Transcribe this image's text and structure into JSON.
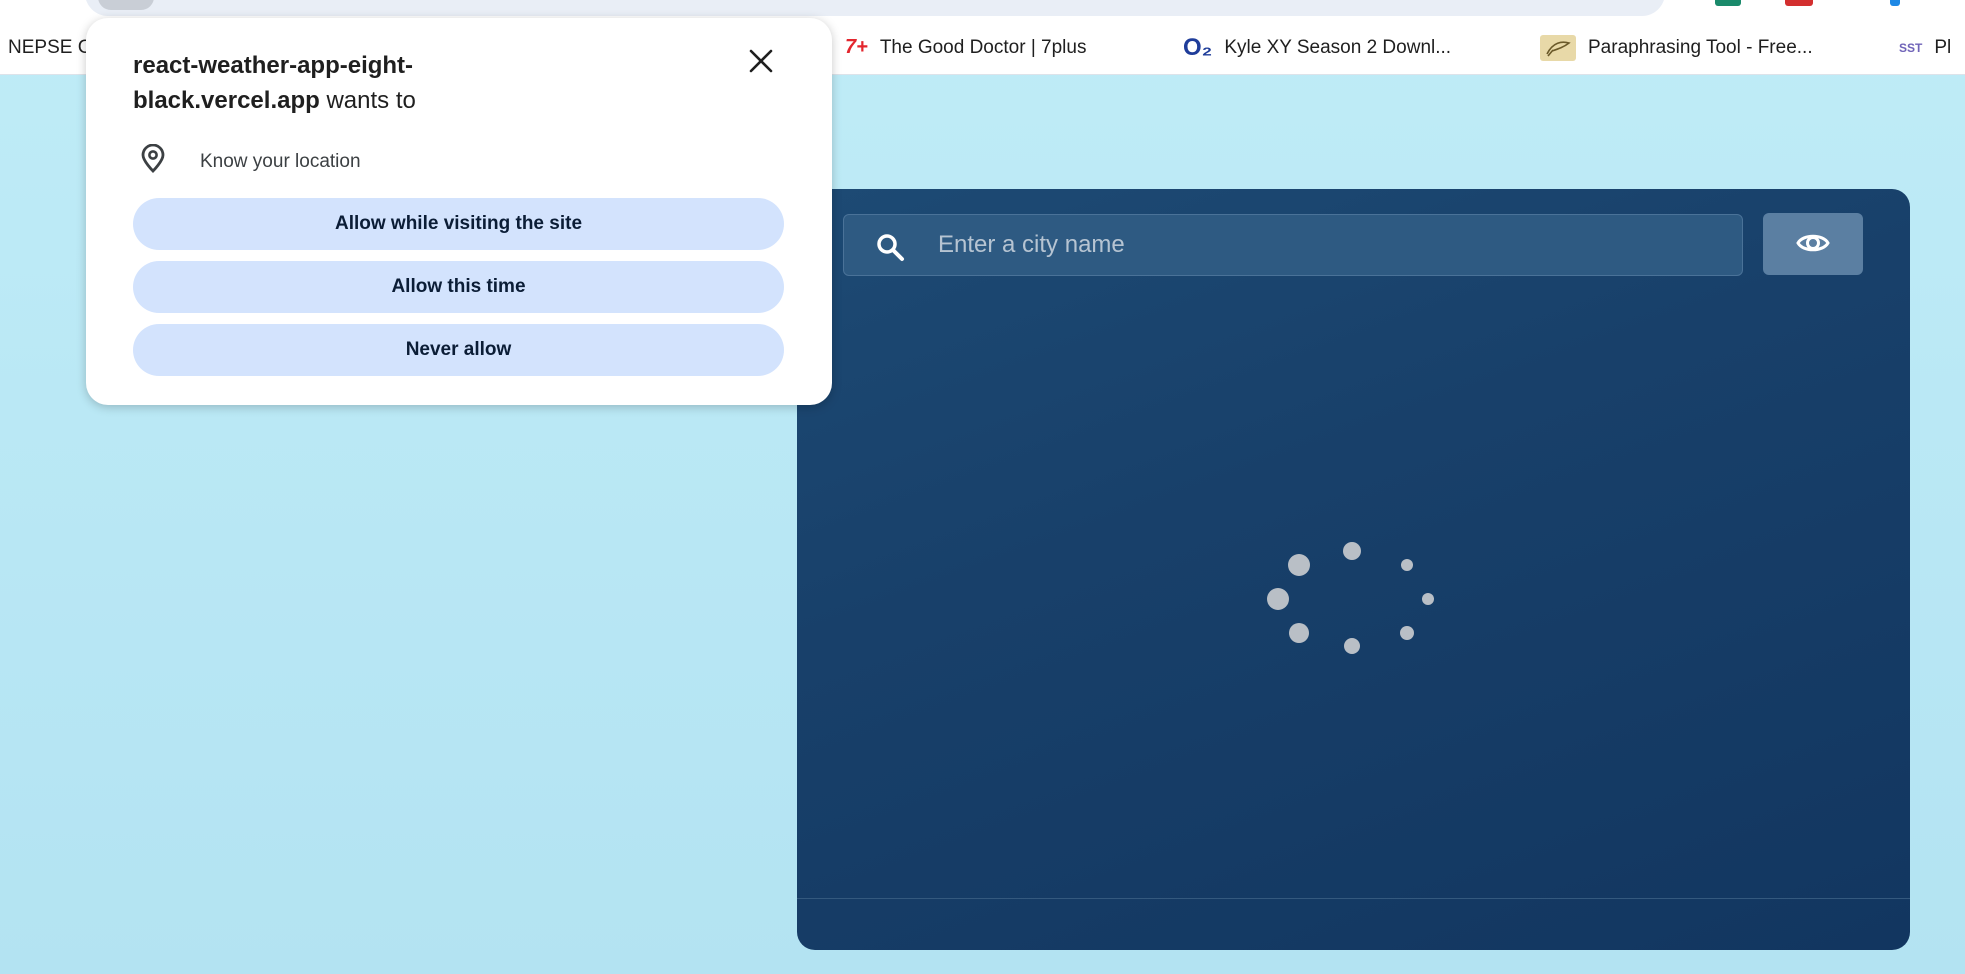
{
  "bookmarks": [
    {
      "label": "NEPSE C",
      "icon": "nepse-icon"
    },
    {
      "label": "The Good Doctor | 7plus",
      "icon": "7plus-icon",
      "fav_text": "7+",
      "fav_color": "#e3262e"
    },
    {
      "label": "Kyle XY Season 2 Downl...",
      "icon": "o2-icon",
      "fav_text": "O₂",
      "fav_color": "#1f3d9a"
    },
    {
      "label": "Paraphrasing Tool - Free...",
      "icon": "quill-icon",
      "fav_color": "#e8d9a8"
    },
    {
      "label": "Pl",
      "icon": "sst-icon",
      "fav_text": "SST",
      "fav_color": "#6f63b8"
    }
  ],
  "permission_popup": {
    "site": "react-weather-app-eight-black.vercel.app",
    "title_line1": "react-weather-app-eight-",
    "title_line2_bold": "black.vercel.app",
    "title_line2_rest": " wants to",
    "permission_label": "Know your location",
    "buttons": {
      "allow_while_visiting": "Allow while visiting the site",
      "allow_this_time": "Allow this time",
      "never_allow": "Never allow"
    }
  },
  "weather_app": {
    "search_placeholder": "Enter a city name",
    "status": "loading"
  },
  "colors": {
    "page_bg": "#b8e6f4",
    "card_bg": "#17416b",
    "popup_button": "#d3e3fd",
    "locate_button": "#5b7fa2"
  }
}
